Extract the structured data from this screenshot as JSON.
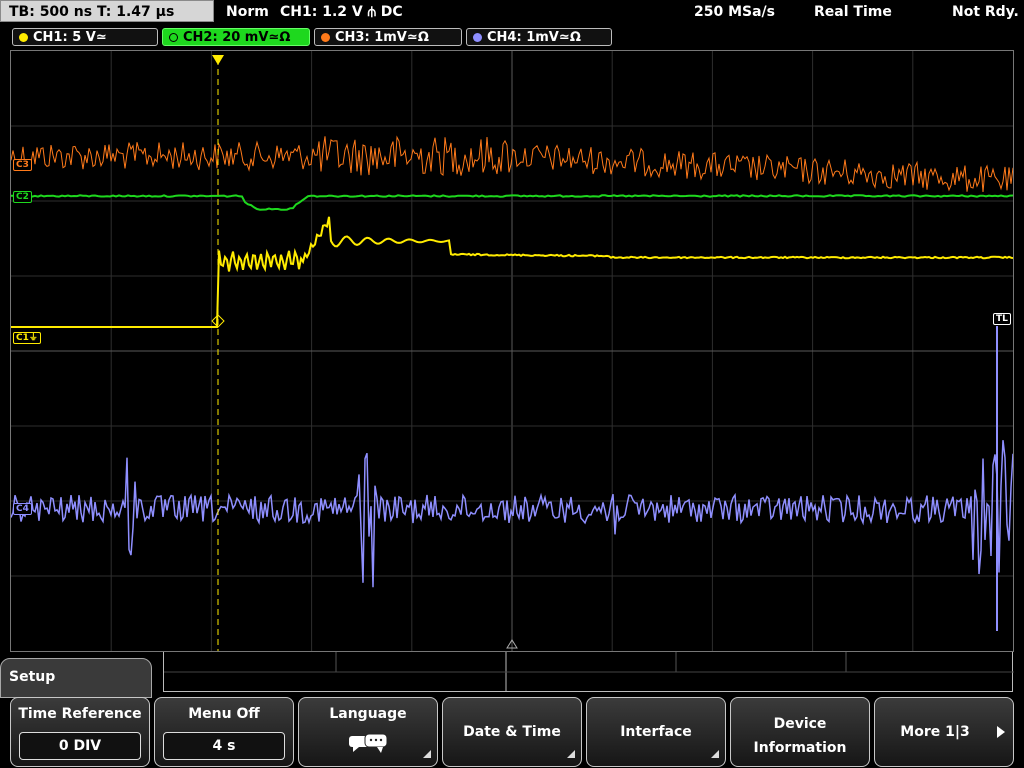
{
  "topbar": {
    "timebase": "TB: 500 ns  T: 1.47 µs",
    "trigger_mode": "Norm",
    "trigger_info": "CH1: 1.2 V ⫛ DC",
    "sample_rate": "250 MSa/s",
    "acq_mode": "Real Time",
    "status": "Not Rdy."
  },
  "channels": [
    {
      "label": "CH1: 5 V≃",
      "color": "#ffeb00",
      "active": false
    },
    {
      "label": "CH2: 20 mV≃Ω",
      "color": "#1ed81e",
      "active": true
    },
    {
      "label": "CH3: 1mV≃Ω",
      "color": "#ff7a1a",
      "active": false
    },
    {
      "label": "CH4: 1mV≃Ω",
      "color": "#8f8fff",
      "active": false
    }
  ],
  "markers": {
    "ch3": "C3",
    "ch2": "C2",
    "ch1": "C1⏚",
    "ch4": "C4",
    "trigger_level": "TL",
    "trigger_pos": "T"
  },
  "menu": {
    "title": "Setup",
    "softkeys": [
      {
        "label": "Time Reference",
        "value": "0 DIV"
      },
      {
        "label": "Menu Off",
        "value": "4 s"
      },
      {
        "label": "Language",
        "icon": "speech-bubble-icon"
      },
      {
        "label": "Date & Time"
      },
      {
        "label": "Interface"
      },
      {
        "label_line1": "Device",
        "label_line2": "Information"
      },
      {
        "label": "More 1|3"
      }
    ]
  },
  "colors": {
    "ch1": "#ffeb00",
    "ch2": "#1ed81e",
    "ch3": "#ff7a1a",
    "ch4": "#8f8fff",
    "grid": "#3a3a3a"
  }
}
